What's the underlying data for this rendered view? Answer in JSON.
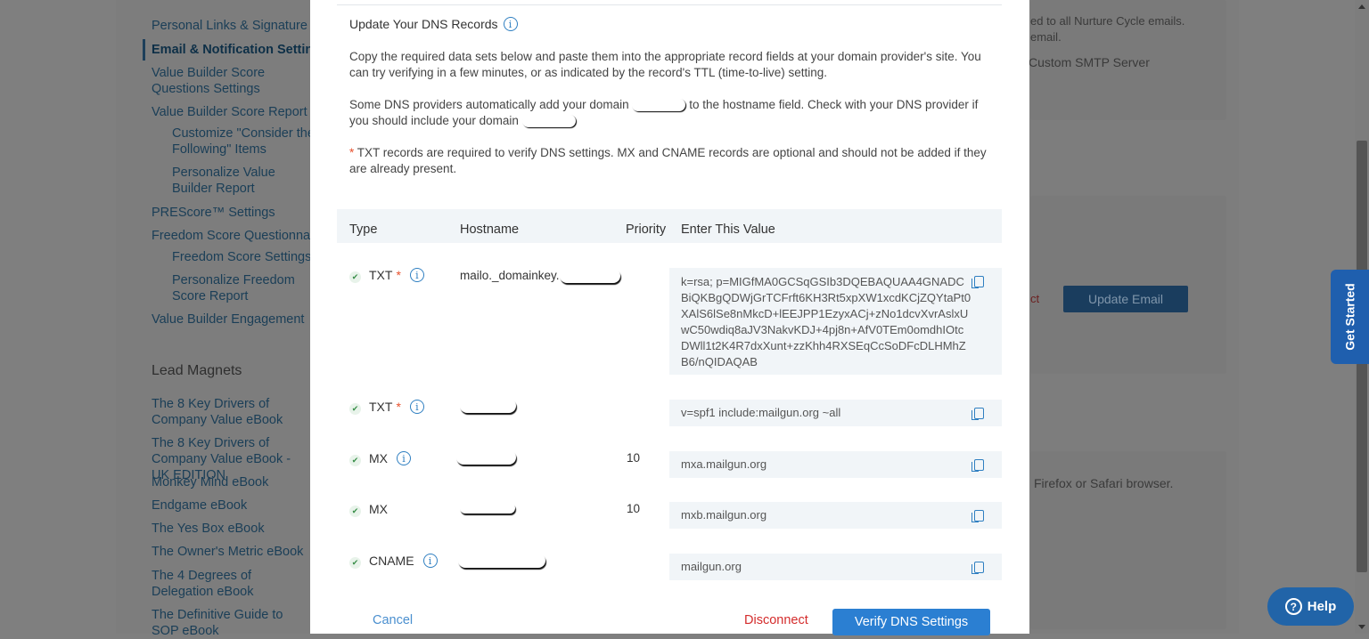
{
  "background": {
    "sidebar": {
      "links": [
        "Personal Links & Signature",
        "Email & Notification Settings",
        "Value Builder Score Questions Settings",
        "Value Builder Score Report",
        "Customize \"Consider the Following\" Items",
        "Personalize Value Builder Report",
        "PREScore™ Settings",
        "Freedom Score Questionnaire",
        "Freedom Score Settings",
        "Personalize Freedom Score Report",
        "Value Builder Engagement"
      ],
      "lead_magnets_heading": "Lead Magnets",
      "lead_magnets": [
        "The 8 Key Drivers of Company Value eBook",
        "The 8 Key Drivers of Company Value eBook - UK EDITION",
        "Monkey Mind eBook",
        "Endgame eBook",
        "The Yes Box eBook",
        "The Owner's Metric eBook",
        "The 4 Degrees of Delegation eBook",
        "The Definitive Guide to SOP eBook"
      ]
    },
    "right_text_1": "ed to all Nurture Cycle emails.",
    "right_text_2": "email.",
    "right_text_3": "Custom SMTP Server",
    "right_text_4": "Firefox or Safari browser.",
    "right_text_5": "ct",
    "update_email_button": "Update Email",
    "get_started": "Get Started",
    "help": "Help"
  },
  "modal": {
    "section_title": "Update Your DNS Records",
    "para1": "Copy the required data sets below and paste them into the appropriate record fields at your domain provider's site. You can try verifying in a few minutes, or as indicated by the record's TTL (time-to-live) setting.",
    "para2_a": "Some DNS providers automatically add your domain",
    "para2_b": "to the hostname field. Check with your DNS provider if you should include your domain",
    "para3_star": "*",
    "para3": " TXT records are required to verify DNS settings. MX and CNAME records are optional and should not be added if they are already present.",
    "columns": [
      "Type",
      "Hostname",
      "Priority",
      "Enter This Value"
    ],
    "rows": [
      {
        "type": "TXT",
        "required": "*",
        "hostname": "mailo._domainkey.",
        "priority": "",
        "value": "k=rsa; p=MIGfMA0GCSqGSIb3DQEBAQUAA4GNADCBiQKBgQDWjGrTCFrft6KH3Rt5xpXW1xcdKCjZQYtaPt0XAlS6lSe8nMkcD+lEEJPP1EzyxACj+zNo1dcvXvrAslxUwC50wdiq8aJV3NakvKDJ+4pj8n+AfV0TEm0omdhIOtcDWll1t2K4R7dxXunt+zzKhh4RXSEqCcSoDFcDLHMhZB6/nQIDAQAB"
      },
      {
        "type": "TXT",
        "required": "*",
        "hostname": "",
        "priority": "",
        "value": "v=spf1 include:mailgun.org ~all"
      },
      {
        "type": "MX",
        "required": "",
        "hostname": "",
        "priority": "10",
        "value": "mxa.mailgun.org"
      },
      {
        "type": "MX",
        "required": "",
        "hostname": "",
        "priority": "10",
        "value": "mxb.mailgun.org"
      },
      {
        "type": "CNAME",
        "required": "",
        "hostname": "",
        "priority": "",
        "value": "mailgun.org"
      }
    ],
    "cancel": "Cancel",
    "disconnect": "Disconnect",
    "verify": "Verify DNS Settings"
  }
}
